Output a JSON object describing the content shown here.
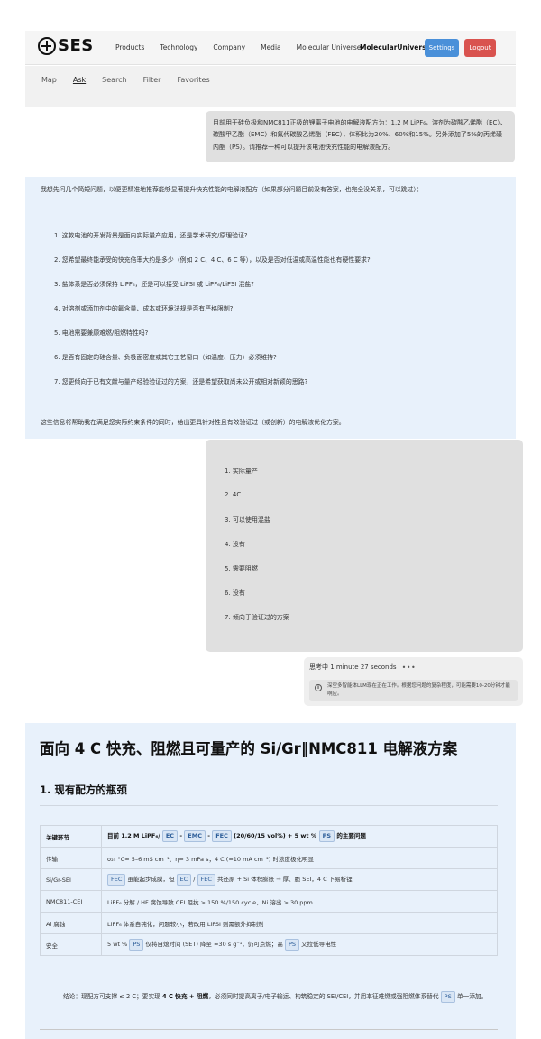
{
  "header": {
    "logo_text": "SES",
    "nav": [
      "Products",
      "Technology",
      "Company",
      "Media",
      "Molecular Universe"
    ],
    "brand": "MolecularUniverse",
    "settings_label": "Settings",
    "logout_label": "Logout"
  },
  "subnav": {
    "items": [
      "Map",
      "Ask",
      "Search",
      "Filter",
      "Favorites"
    ],
    "active": "Ask"
  },
  "chat": {
    "user_message_1": "目前用于硅负极和NMC811正极的锂离子电池的电解液配方为：1.2 M LiPF₆，溶剂为碳酸乙烯酯（EC）、碳酸甲乙酯（EMC）和氟代碳酸乙烯酯（FEC），体积比为20%、60%和15%。另外添加了5%的丙烯磺内酯（PS）。请推荐一种可以提升该电池快充性能的电解液配方。",
    "assistant_intro": "我想先问几个简短问题，以便更精准地推荐能够显著提升快充性能的电解液配方（如果部分问题目前没有答案，也完全没关系，可以跳过）：",
    "assistant_questions": [
      "1. 这款电池的开发背景是面向实际量产应用，还是学术研究/原理验证?",
      "2. 您希望最终能承受的快充倍率大约是多少（例如 2 C、4 C、6 C 等），以及是否对低温或高温性能也有硬性要求?",
      "3. 盐体系是否必须保持 LiPF₆，还是可以接受 LiFSI 或 LiPF₆/LiFSI 混盐?",
      "4. 对溶剂或添加剂中的氟含量、成本或环境法规是否有严格限制?",
      "5. 电池需要兼顾难燃/阻燃特性吗?",
      "6. 是否有固定的硅含量、负极面密度或其它工艺窗口（如温度、压力）必须维持?",
      "7. 您更倾向于已有文献与量产经验验证过的方案，还是希望获取尚未公开或相对新颖的思路?"
    ],
    "assistant_outro": "这些信息将帮助我在满足您实际约束条件的同时，给出更具针对性且有效验证过（或创新）的电解液优化方案。",
    "user_answers": [
      "1. 实际量产",
      "2. 4C",
      "3. 可以使用混盐",
      "4. 没有",
      "5. 需要阻燃",
      "6. 没有",
      "7. 倾向于验证过的方案"
    ],
    "thinking_label": "思考中 1 minute 27 seconds",
    "notice": "深空多智能体LLM现在正在工作。根据您问题的复杂程度，可能需要10-20分钟才能响应。"
  },
  "report": {
    "title": "面向 4 C 快充、阻燃且可量产的 Si/Gr‖NMC811 电解液方案",
    "section1_title": "1. 现有配方的瓶颈",
    "table": {
      "header_key": "关键环节",
      "header_pre": "目前 1.2 M LiPF₆/",
      "header_post": "(20/60/15 vol%) + 5 wt %",
      "header_end": "的主要问题",
      "rows": [
        {
          "key": "传输",
          "text": "σ₂₅ °C≈ 5–6 mS cm⁻¹、η≈ 3 mPa s；4 C (≈10 mA cm⁻²) 时浓度极化明显"
        },
        {
          "key": "Si/Gr-SEI",
          "text_a": "虽能起步成膜，但",
          "text_b": "共还原 + Si 体积膨胀 → 厚、脆 SEI，4 C 下易析锂"
        },
        {
          "key": "NMC811-CEI",
          "text": "LiPF₆ 分解 / HF 腐蚀导致 CEI 阻抗 > 150 %/150 cycle，Ni 溶出 > 30 ppm"
        },
        {
          "key": "Al 腐蚀",
          "text": "LiPF₆ 体系自钝化，问题较小；若改用 LiFSI 则需额外抑制剂"
        },
        {
          "key": "安全",
          "text_a": "5 wt %",
          "text_b": "仅将自熄时间 (SET) 降至 ≈30 s g⁻¹，仍可点燃；高",
          "text_c": "又拉低导电性"
        }
      ]
    },
    "tags": {
      "ec": "EC",
      "emc": "EMC",
      "fec": "FEC",
      "ps": "PS"
    },
    "conclusion_a": "结论：现配方可支撑 ≤ 2 C；要实现 ",
    "conclusion_bold": "4 C 快充 + 阻燃",
    "conclusion_b": "，必须同时提高离子/电子输运、构筑稳定的 SEI/CEI，并用本征难燃或强阻燃体系替代",
    "conclusion_c": "单一添加。"
  }
}
